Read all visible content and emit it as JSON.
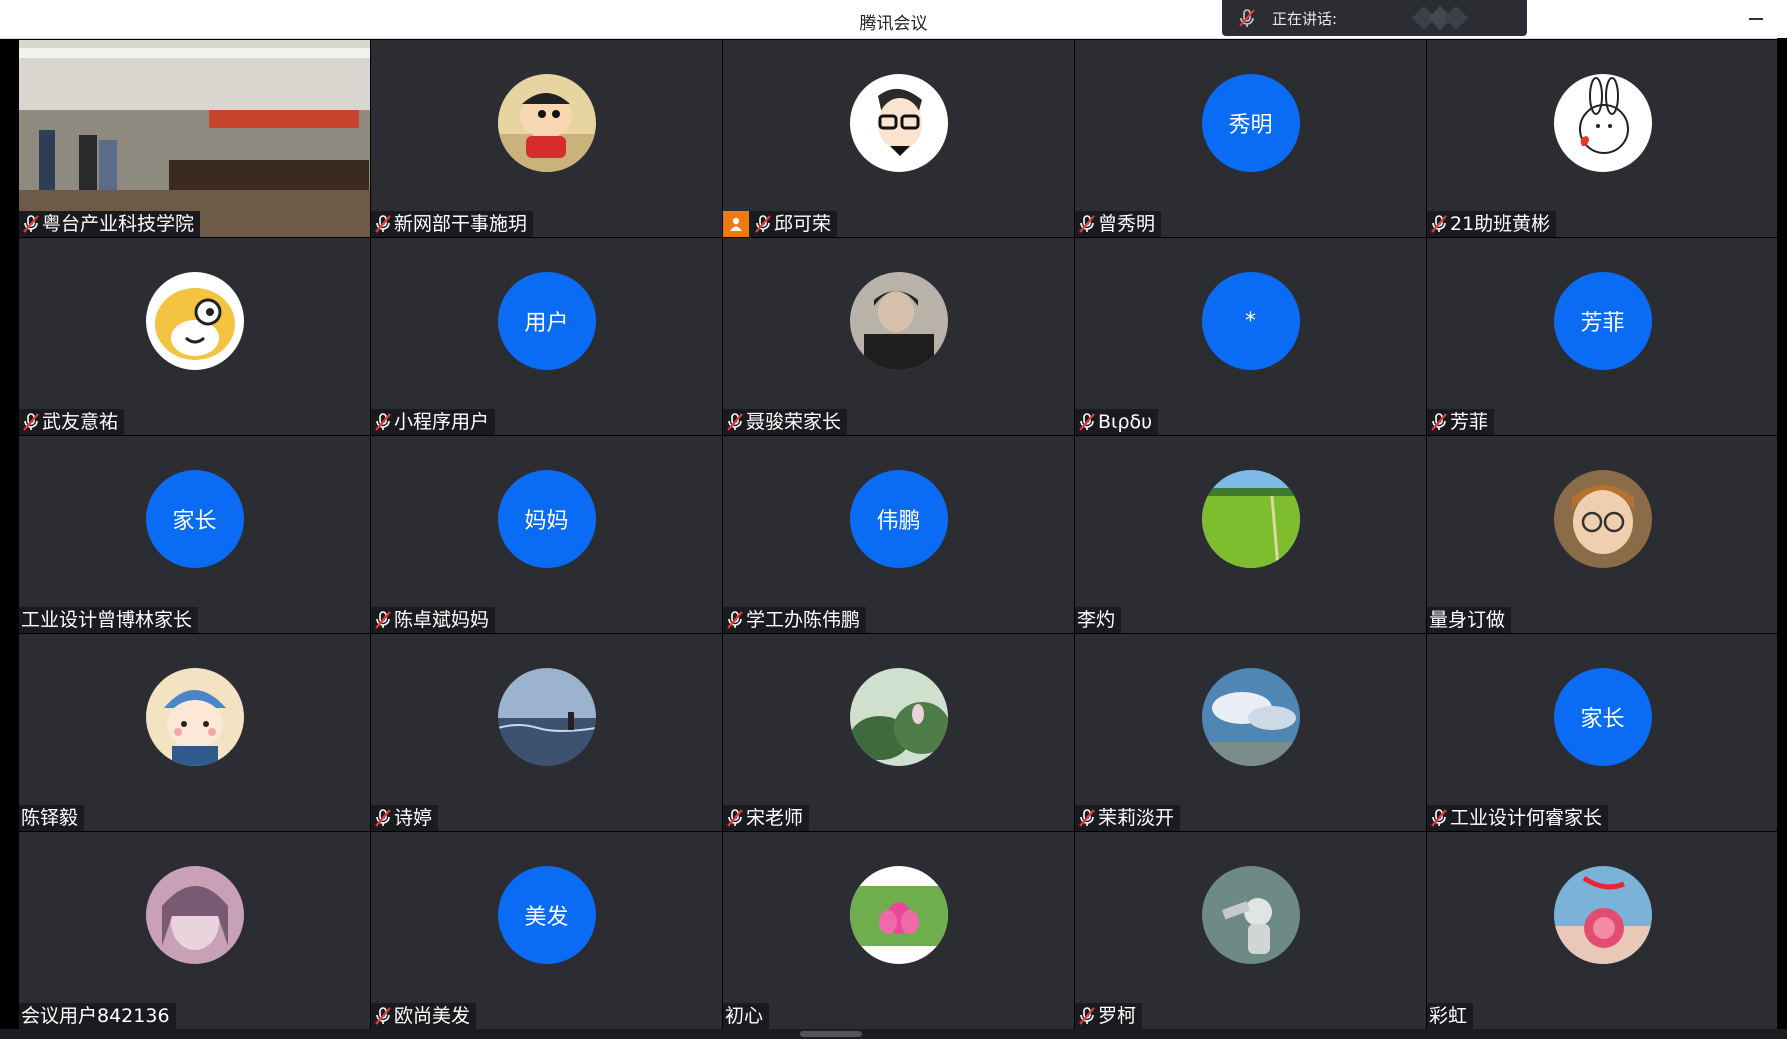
{
  "app": {
    "title": "腾讯会议"
  },
  "speaking": {
    "label": "正在讲话:"
  },
  "colors": {
    "tile_bg": "#2b2d33",
    "text_avatar_bg": "#0a6cf5",
    "host_badge": "#f07a10",
    "mic_muted": "#e53b3b"
  },
  "participants": [
    {
      "name": "粤台产业科技学院",
      "muted": true,
      "avatar": "video-feed"
    },
    {
      "name": "新网部干事施玥",
      "muted": true,
      "avatar": "cartoon-boy"
    },
    {
      "name": "邱可荣",
      "muted": true,
      "host": true,
      "avatar": "cartoon-glasses-man"
    },
    {
      "name": "曾秀明",
      "muted": true,
      "avatar_text": "秀明"
    },
    {
      "name": "21助班黄彬",
      "muted": true,
      "avatar": "bunny-sketch"
    },
    {
      "name": "武友意祐",
      "muted": true,
      "avatar": "cartoon-dog"
    },
    {
      "name": "小程序用户",
      "muted": true,
      "avatar_text": "用户"
    },
    {
      "name": "聂骏荣家长",
      "muted": true,
      "avatar": "photo-person"
    },
    {
      "name": "Βιρδυ",
      "muted": true,
      "avatar_text": "*"
    },
    {
      "name": "芳菲",
      "muted": true,
      "avatar_text": "芳菲"
    },
    {
      "name": "工业设计曾博林家长",
      "muted": false,
      "avatar_text": "家长"
    },
    {
      "name": "陈卓斌妈妈",
      "muted": true,
      "avatar_text": "妈妈"
    },
    {
      "name": "学工办陈伟鹏",
      "muted": true,
      "avatar_text": "伟鹏"
    },
    {
      "name": "李灼",
      "muted": false,
      "avatar": "green-field"
    },
    {
      "name": "量身订做",
      "muted": false,
      "avatar": "child-glasses"
    },
    {
      "name": "陈铎毅",
      "muted": false,
      "avatar": "cartoon-boy-hat"
    },
    {
      "name": "诗婷",
      "muted": true,
      "avatar": "sea-sunset"
    },
    {
      "name": "宋老师",
      "muted": true,
      "avatar": "lotus-leaves"
    },
    {
      "name": "茉莉淡开",
      "muted": true,
      "avatar": "sky-clouds"
    },
    {
      "name": "工业设计何睿家长",
      "muted": true,
      "avatar_text": "家长"
    },
    {
      "name": "会议用户842136",
      "muted": false,
      "avatar": "anime-girl"
    },
    {
      "name": "欧尚美发",
      "muted": true,
      "avatar_text": "美发"
    },
    {
      "name": "初心",
      "muted": false,
      "avatar": "pink-lotus"
    },
    {
      "name": "罗柯",
      "muted": true,
      "avatar": "astronaut"
    },
    {
      "name": "彩虹",
      "muted": false,
      "avatar": "rose-hand"
    }
  ]
}
